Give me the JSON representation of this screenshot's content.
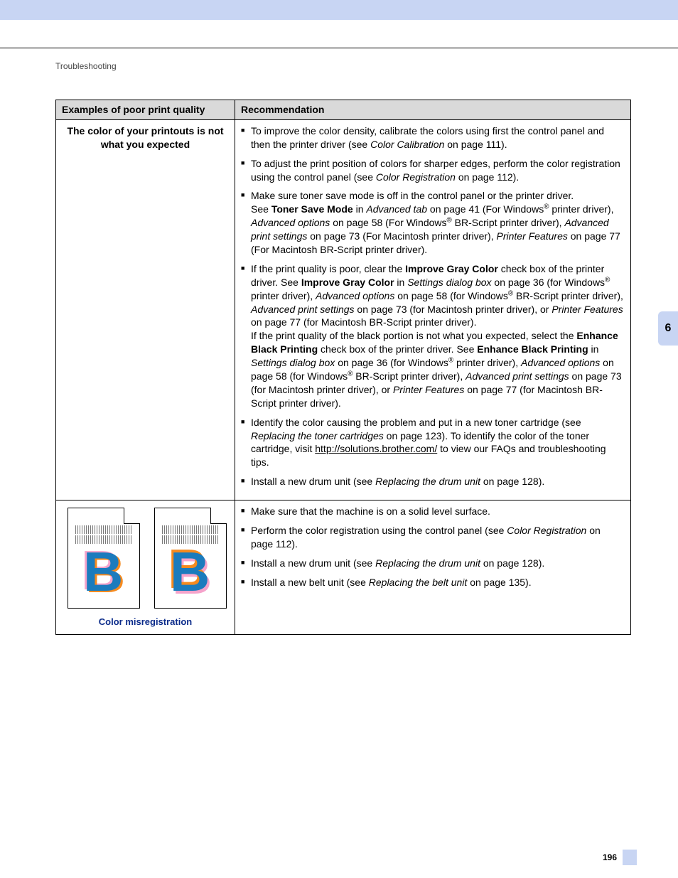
{
  "header": {
    "section": "Troubleshooting"
  },
  "sidetab": {
    "chapter": "6"
  },
  "footer": {
    "page": "196"
  },
  "table": {
    "headers": {
      "col1": "Examples of poor print quality",
      "col2": "Recommendation"
    },
    "row1": {
      "title": "The color of your printouts is not what you expected",
      "b1a": "To improve the color density, calibrate the colors using first the control panel and then the printer driver (see ",
      "b1b": "Color Calibration",
      "b1c": " on page 111).",
      "b2a": "To adjust the print position of colors for sharper edges, perform the color registration using the control panel (see ",
      "b2b": "Color Registration",
      "b2c": " on page 112).",
      "b3a": "Make sure toner save mode is off in the control panel or the printer driver.",
      "b3b": "See ",
      "b3c": "Toner Save Mode",
      "b3d": " in ",
      "b3e": "Advanced tab",
      "b3f": " on page 41 (For Windows",
      "b3g": "®",
      "b3h": " printer driver), ",
      "b3i": "Advanced options",
      "b3j": " on page 58 (For Windows",
      "b3k": "®",
      "b3l": " BR-Script printer driver), ",
      "b3m": "Advanced print settings",
      "b3n": " on page 73 (For Macintosh printer driver), ",
      "b3o": "Printer Features",
      "b3p": " on page 77 (For Macintosh BR-Script printer driver).",
      "b4a": "If the print quality is poor, clear the ",
      "b4b": "Improve Gray Color",
      "b4c": " check box of the printer driver. See ",
      "b4d": "Improve Gray Color",
      "b4e": " in ",
      "b4f": "Settings dialog box",
      "b4g": " on page 36 (for Windows",
      "b4h": "®",
      "b4i": " printer driver), ",
      "b4j": "Advanced options",
      "b4k": " on page 58 (for Windows",
      "b4l": "®",
      "b4m": " BR-Script printer driver), ",
      "b4n": "Advanced print settings",
      "b4o": " on page 73 (for Macintosh printer driver), or ",
      "b4p": "Printer Features",
      "b4q": " on page 77 (for Macintosh BR-Script printer driver).",
      "b4r": "If the print quality of the black portion is not what you expected, select the ",
      "b4s": "Enhance Black Printing",
      "b4t": " check box of the printer driver. See ",
      "b4u": "Enhance Black Printing",
      "b4v": " in ",
      "b4w": "Settings dialog box",
      "b4x": " on page 36 (for Windows",
      "b4y": "®",
      "b4z": " printer driver), ",
      "b4aa": "Advanced options",
      "b4ab": " on page 58 (for Windows",
      "b4ac": "®",
      "b4ad": " BR-Script printer driver), ",
      "b4ae": "Advanced print settings",
      "b4af": " on page 73 (for Macintosh printer driver), or ",
      "b4ag": "Printer Features",
      "b4ah": " on page 77 (for Macintosh BR-Script printer driver).",
      "b5a": "Identify the color causing the problem and put in a new toner cartridge (see ",
      "b5b": "Replacing the toner cartridges",
      "b5c": " on page 123). To identify the color of the toner cartridge, visit ",
      "b5d": "http://solutions.brother.com/",
      "b5e": " to view our FAQs and troubleshooting tips.",
      "b6a": "Install a new drum unit (see ",
      "b6b": "Replacing the drum unit",
      "b6c": " on page 128)."
    },
    "row2": {
      "caption": "Color misregistration",
      "letter": "B",
      "b1": "Make sure that the machine is on a solid level surface.",
      "b2a": "Perform the color registration using the control panel (see ",
      "b2b": "Color Registration",
      "b2c": " on page 112).",
      "b3a": "Install a new drum unit (see ",
      "b3b": "Replacing the drum unit",
      "b3c": " on page 128).",
      "b4a": "Install a new belt unit (see ",
      "b4b": "Replacing the belt unit",
      "b4c": " on page 135)."
    }
  }
}
